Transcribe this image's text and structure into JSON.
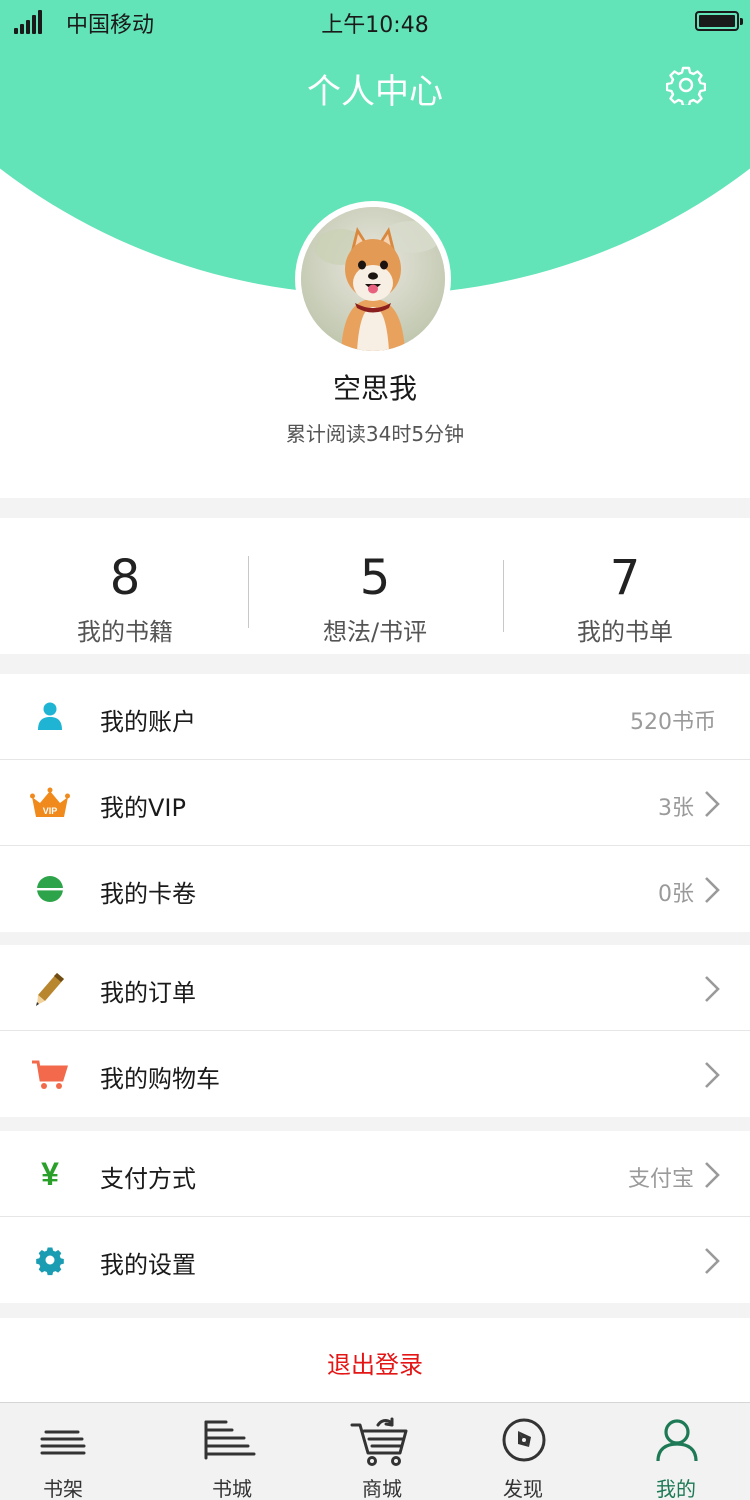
{
  "status_bar": {
    "carrier": "中国移动",
    "time": "上午10:48"
  },
  "header": {
    "title": "个人中心"
  },
  "profile": {
    "username": "空思我",
    "reading_time": "累计阅读34时5分钟"
  },
  "stats": [
    {
      "value": "8",
      "label": "我的书籍"
    },
    {
      "value": "5",
      "label": "想法/书评"
    },
    {
      "value": "7",
      "label": "我的书单"
    }
  ],
  "menu": {
    "account": {
      "label": "我的账户",
      "value": "520书币",
      "icon": "person-icon"
    },
    "vip": {
      "label": "我的VIP",
      "value": "3张",
      "icon": "crown-icon",
      "badge_text": "VIP"
    },
    "coupons": {
      "label": "我的卡卷",
      "value": "0张",
      "icon": "coupon-icon"
    },
    "orders": {
      "label": "我的订单",
      "value": "",
      "icon": "pencil-icon"
    },
    "cart": {
      "label": "我的购物车",
      "value": "",
      "icon": "cart-icon"
    },
    "payment": {
      "label": "支付方式",
      "value": "支付宝",
      "icon": "yen-icon",
      "symbol": "¥"
    },
    "settings": {
      "label": "我的设置",
      "value": "",
      "icon": "gear-icon"
    }
  },
  "logout": {
    "label": "退出登录"
  },
  "tabbar": [
    {
      "label": "书架",
      "icon": "bookshelf-icon",
      "active": false
    },
    {
      "label": "书城",
      "icon": "bookstore-icon",
      "active": false
    },
    {
      "label": "商城",
      "icon": "cart-icon",
      "active": false
    },
    {
      "label": "发现",
      "icon": "compass-icon",
      "active": false
    },
    {
      "label": "我的",
      "icon": "user-icon",
      "active": true
    }
  ],
  "colors": {
    "accent": "#62e3b8",
    "tab_active": "#1e7a56",
    "logout": "#e41515",
    "account_icon": "#1fb4d3",
    "vip_icon": "#f08a1c",
    "coupon_icon": "#2da34a",
    "orders_icon": "#b8862e",
    "cart_icon": "#f26a4b",
    "payment_icon": "#2aa02a",
    "settings_icon": "#1a9cb3"
  }
}
